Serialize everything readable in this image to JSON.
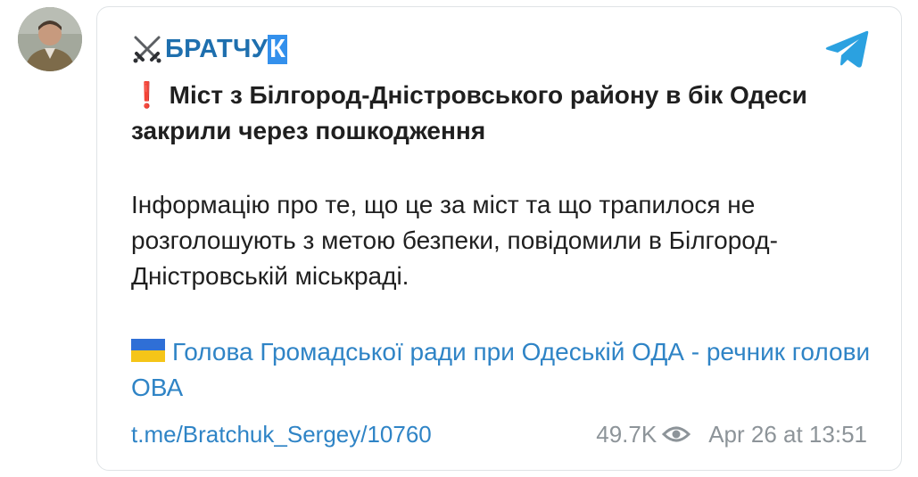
{
  "channel": {
    "name_main": "БРАТЧУ",
    "name_highlight": "К",
    "icon": "crossed-swords-icon"
  },
  "post": {
    "headline_mark": "❗",
    "headline": "Міст з Білгород-Дністровського району в бік Одеси закрили через пошкодження",
    "body": "Інформацію про те, що це за міст та що трапилося не розголошують з метою безпеки, повідомили в Білгород-Дністровській міськраді.",
    "link_flag": "ukraine-flag-icon",
    "link_text": "Голова Громадської ради при Одеській ОДА - речник голови ОВА"
  },
  "footer": {
    "post_link": "t.me/Bratchuk_Sergey/10760",
    "views": "49.7K",
    "date": "Apr 26 at 13:51"
  },
  "colors": {
    "link": "#2f84c6",
    "channel": "#1e6fae",
    "highlight": "#3390ec",
    "telegram": "#2ba1e0",
    "meta": "#8d9499",
    "alert": "#e0242b"
  }
}
